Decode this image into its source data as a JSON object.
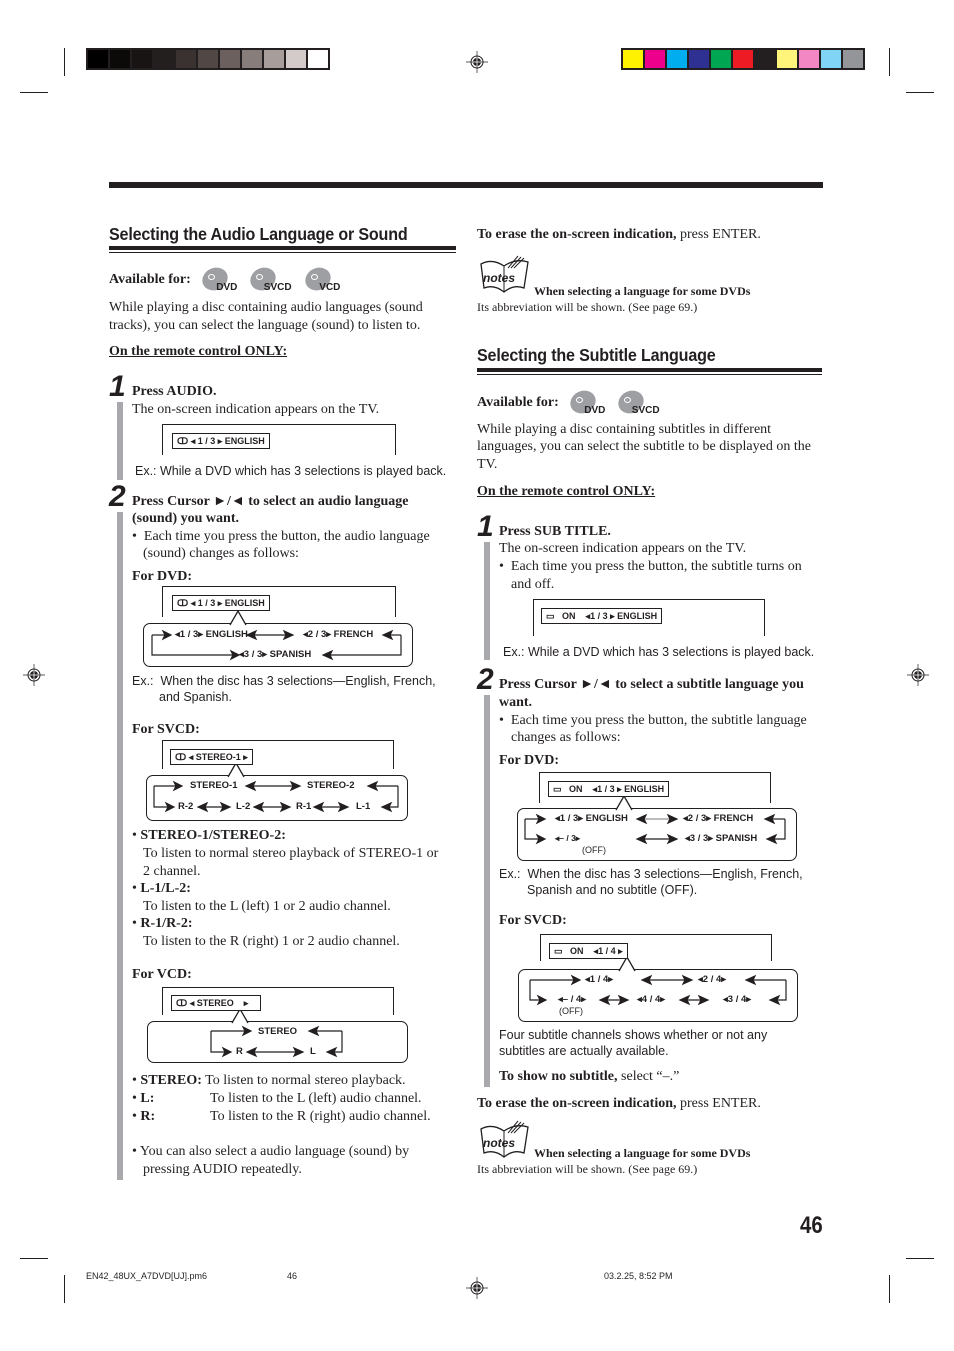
{
  "registration": {
    "gray_swatches": [
      "#000000",
      "#0b0a09",
      "#171413",
      "#231f1e",
      "#3a3230",
      "#514745",
      "#6b605e",
      "#877e7c",
      "#a79e9c",
      "#d3cbca",
      "#ffffff"
    ],
    "color_swatches": [
      "#fff200",
      "#ec008c",
      "#00aeef",
      "#2e3192",
      "#00a651",
      "#ed1c24",
      "#231f20",
      "#fff57a",
      "#f287c4",
      "#80d4f6",
      "#939598"
    ]
  },
  "left": {
    "heading": "Selecting the Audio Language or Sound",
    "available_label": "Available for:",
    "discs": [
      "DVD",
      "SVCD",
      "VCD"
    ],
    "intro": "While playing a disc containing audio languages (sound tracks), you can select the language (sound) to listen to.",
    "remote_only": "On the remote control ONLY:",
    "step1": {
      "num": "1",
      "title": "Press AUDIO.",
      "text": "The on-screen indication appears on the TV.",
      "osd": "1 / 3",
      "osd_lang": "ENGLISH",
      "example": "Ex.: While a DVD which has 3 selections is played back."
    },
    "step2": {
      "num": "2",
      "title_line1": "Press Cursor ►/◄ to select an audio language",
      "title_line2": "(sound) you want.",
      "bullet_line1": "•  Each time you press the button, the audio language",
      "bullet_line2": "(sound) changes as follows:",
      "for_dvd": "For DVD:",
      "dvd_osd": "1 / 3",
      "dvd_osd_lang": "ENGLISH",
      "dvd_cycle": [
        "◂1 / 3▸ ENGLISH",
        "◂2 / 3▸ FRENCH",
        "◂3 / 3▸ SPANISH"
      ],
      "dvd_example_line1": "Ex.:  When the disc has 3 selections—English, French,",
      "dvd_example_line2": "and Spanish.",
      "for_svcd": "For SVCD:",
      "svcd_osd": "STEREO-1",
      "svcd_cycle_top": [
        "STEREO-1",
        "STEREO-2"
      ],
      "svcd_cycle_bottom": [
        "R-2",
        "L-2",
        "R-1",
        "L-1"
      ],
      "defs": [
        {
          "term": "STEREO-1/STEREO-2:",
          "line1": "To listen to normal stereo playback of STEREO-1 or",
          "line2": "2 channel."
        },
        {
          "term": "L-1/L-2:",
          "line1": "To listen to the L (left) 1 or 2 audio channel."
        },
        {
          "term": "R-1/R-2:",
          "line1": "To listen to the R (right) 1 or 2 audio channel."
        }
      ],
      "for_vcd": "For VCD:",
      "vcd_osd": "STEREO",
      "vcd_cycle": [
        "STEREO",
        "R",
        "L"
      ],
      "vcd_defs": [
        {
          "term": "STEREO:",
          "text": "To listen to normal stereo playback."
        },
        {
          "term": "L:",
          "text": "To listen to the L (left) audio channel."
        },
        {
          "term": "R:",
          "text": "To listen to the R (right) audio channel."
        }
      ],
      "also_line1": "You can also select a audio language (sound) by",
      "also_line2": "pressing AUDIO repeatedly."
    }
  },
  "right": {
    "erase1_bold": "To erase the on-screen indication,",
    "erase1_rest": " press ENTER.",
    "notes_icon": "notes",
    "note1_title": "When selecting a language for some DVDs",
    "note1_text": "Its abbreviation will be shown. (See page 69.)",
    "heading": "Selecting the Subtitle Language",
    "available_label": "Available for:",
    "discs": [
      "DVD",
      "SVCD"
    ],
    "intro_line1": "While playing a disc containing subtitles in different",
    "intro_line2": "languages, you can select the subtitle to be displayed on the",
    "intro_line3": "TV.",
    "remote_only": "On the remote control ONLY:",
    "step1": {
      "num": "1",
      "title": "Press SUB TITLE.",
      "text": "The on-screen indication appears on the TV.",
      "bullet_line1": "•  Each time you press the button, the subtitle turns on",
      "bullet_line2": "and off.",
      "osd_on": "ON",
      "osd": "1 / 3",
      "osd_lang": "ENGLISH",
      "example": "Ex.: While a DVD which has 3 selections is played back."
    },
    "step2": {
      "num": "2",
      "title_line1": "Press Cursor ►/◄ to select a subtitle language you",
      "title_line2": "want.",
      "bullet_line1": "•  Each time you press the button, the subtitle language",
      "bullet_line2": "changes as follows:",
      "for_dvd": "For DVD:",
      "dvd_osd_on": "ON",
      "dvd_osd": "1 / 3",
      "dvd_osd_lang": "ENGLISH",
      "dvd_cycle": [
        "◂1 / 3▸ ENGLISH",
        "◂2 / 3▸ FRENCH",
        "◂– / 3▸",
        "◂3 / 3▸ SPANISH"
      ],
      "off_label": "(OFF)",
      "dvd_example_line1": "Ex.:  When the disc has 3 selections—English, French,",
      "dvd_example_line2": "Spanish and no subtitle (OFF).",
      "for_svcd": "For SVCD:",
      "svcd_osd_on": "ON",
      "svcd_osd": "1 / 4",
      "svcd_cycle": [
        "◂1 / 4▸",
        "◂2 / 4▸",
        "◂– / 4▸",
        "◂4 / 4▸",
        "◂3 / 4▸"
      ],
      "svcd_note_line1": "Four subtitle channels shows whether or not any",
      "svcd_note_line2": "subtitles are actually available.",
      "no_sub_bold": "To show no subtitle,",
      "no_sub_rest": " select “–.”"
    },
    "erase2_bold": "To erase the on-screen indication,",
    "erase2_rest": " press ENTER.",
    "note2_title": "When selecting a language for some DVDs",
    "note2_text": "Its abbreviation will be shown. (See page 69.)"
  },
  "page_number": "46",
  "footer": {
    "file": "EN42_48UX_A7DVD[UJ].pm6",
    "page": "46",
    "date": "03.2.25, 8:52 PM"
  }
}
